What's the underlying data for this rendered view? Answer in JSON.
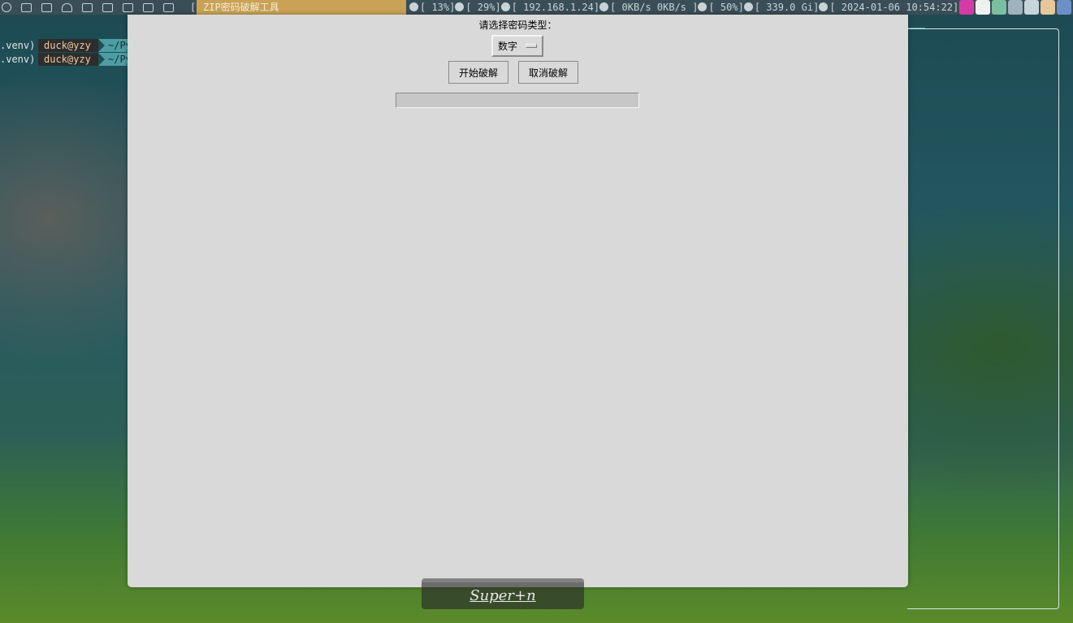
{
  "topbar": {
    "icons": [
      "settings-icon",
      "chat-icon",
      "terminal-icon",
      "notification-icon",
      "folder-icon",
      "app-icon",
      "gamepad-icon",
      "markdown-icon",
      "monitor-icon"
    ],
    "layout_indicator": "[]=",
    "active_window_title": "ZIP密码破解工具",
    "status": {
      "cpu": "[ 13%]",
      "memory": "[ 29%]",
      "ip": "[ 192.168.1.24]",
      "network": "[ 0KB/s  0KB/s  ]",
      "volume": "[ 50%]",
      "disk": "[ 339.0 Gi]",
      "datetime": "[ 2024-01-06 10:54:22]"
    },
    "tray_colors": [
      "#d63aa8",
      "#f0f0f0",
      "#7ac0a0",
      "#9fb3be",
      "#c7d4da",
      "#e8c79a",
      "#6c8fc7"
    ]
  },
  "terminal": {
    "lines": [
      {
        "env": ".venv)",
        "user": "duck@yzy",
        "path": "~/Py"
      },
      {
        "env": ".venv)",
        "user": "duck@yzy",
        "path": "~/Py"
      }
    ]
  },
  "app": {
    "prompt_label": "请选择密码类型：",
    "password_type_selected": "数字",
    "start_button": "开始破解",
    "cancel_button": "取消破解",
    "progress": 0
  },
  "hint": {
    "text": "Super+n"
  }
}
